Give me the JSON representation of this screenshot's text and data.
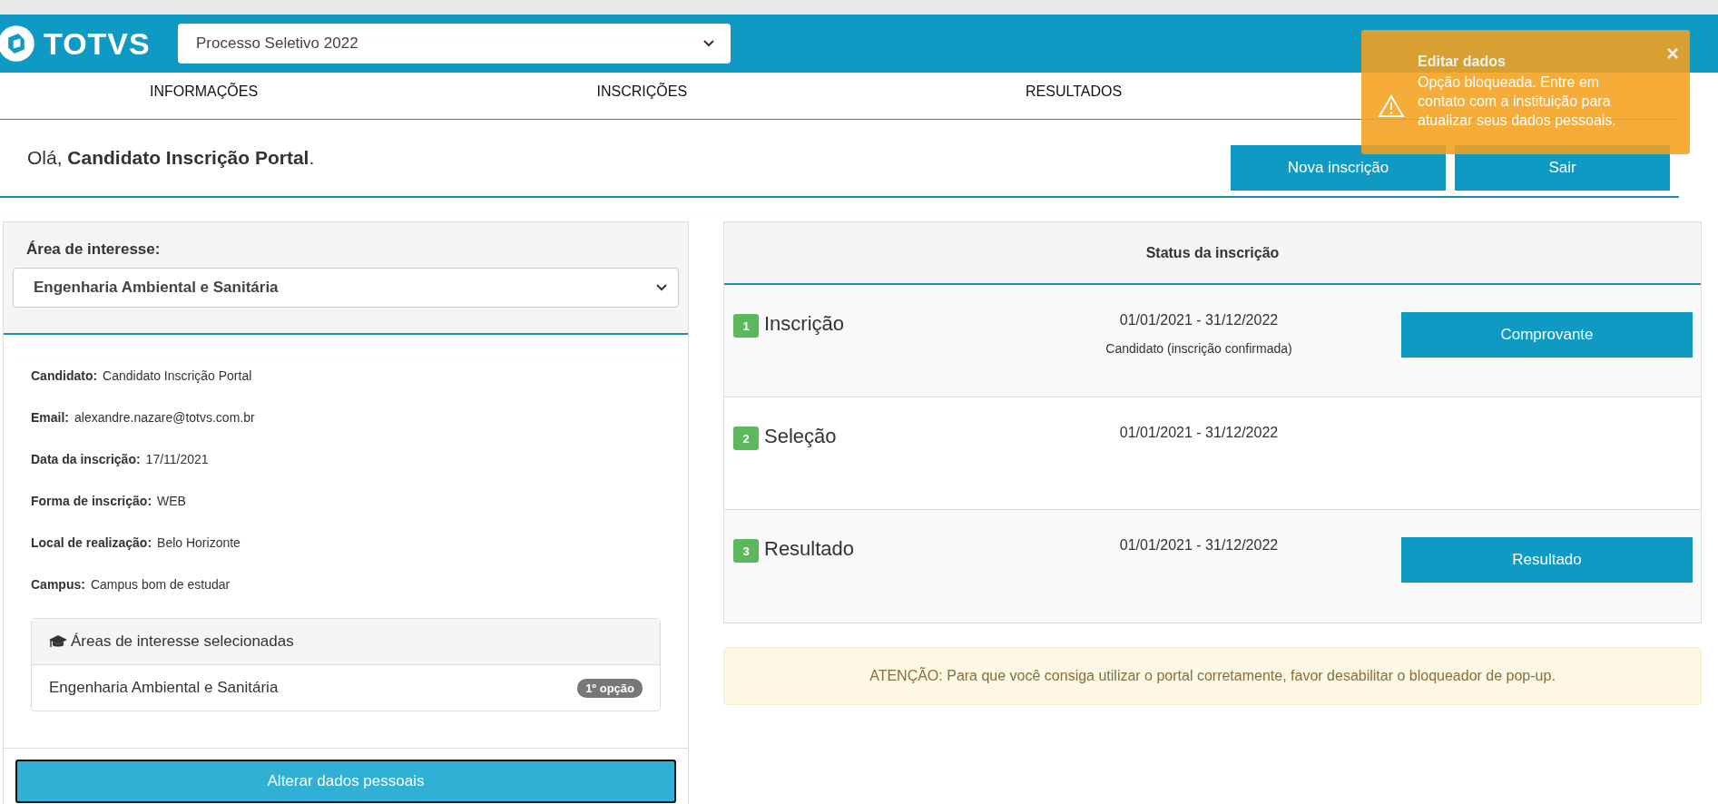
{
  "header": {
    "logo": "TOTVS",
    "process_select": {
      "value": "Processo Seletivo 2022"
    }
  },
  "nav": [
    {
      "label": "INFORMAÇÕES"
    },
    {
      "label": "INSCRIÇÕES"
    },
    {
      "label": "RESULTADOS"
    }
  ],
  "greeting": {
    "prefix": "Olá,",
    "name": "Candidato Inscrição Portal",
    "suffix": "."
  },
  "actions": [
    "Nova inscrição",
    "Sair"
  ],
  "left_panel": {
    "area_label": "Área de interesse:",
    "area_select": {
      "value": "Engenharia Ambiental e Sanitária"
    },
    "fields": [
      {
        "label": "Candidato:",
        "value": "Candidato Inscrição Portal"
      },
      {
        "label": "Email:",
        "value": "alexandre.nazare@totvs.com.br"
      },
      {
        "label": "Data da inscrição:",
        "value": "17/11/2021"
      },
      {
        "label": "Forma de inscrição:",
        "value": "WEB"
      },
      {
        "label": "Local de realização:",
        "value": "Belo Horizonte"
      },
      {
        "label": "Campus:",
        "value": "Campus bom de estudar"
      }
    ],
    "selected_areas": {
      "title": "Áreas de interesse selecionadas",
      "items": [
        {
          "name": "Engenharia Ambiental e Sanitária",
          "badge": "1º opção"
        }
      ]
    },
    "button": "Alterar dados pessoais"
  },
  "status_panel": {
    "title": "Status da inscrição",
    "steps": [
      {
        "number": "1",
        "name": "Inscrição",
        "dates": "01/01/2021 - 31/12/2022",
        "note": "Candidato (inscrição confirmada)",
        "button": "Comprovante"
      },
      {
        "number": "2",
        "name": "Seleção",
        "dates": "01/01/2021 - 31/12/2022"
      },
      {
        "number": "3",
        "name": "Resultado",
        "dates": "01/01/2021 - 31/12/2022",
        "button": "Resultado"
      }
    ]
  },
  "alert": "ATENÇÃO: Para que você consiga utilizar o portal corretamente, favor desabilitar o bloqueador de pop-up.",
  "toast": {
    "title": "Editar dados",
    "message": "Opção bloqueada. Entre em contato com a instituição para atualizar seus dados pessoais.",
    "close": "×"
  }
}
